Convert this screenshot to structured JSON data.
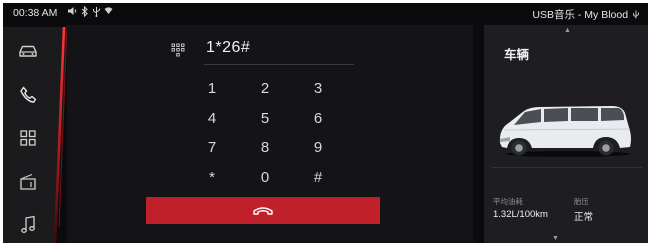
{
  "status_bar": {
    "time": "00:38 AM",
    "icons": [
      "speaker-icon",
      "bluetooth-icon",
      "usb-icon",
      "wifi-icon"
    ],
    "media": "USB音乐 - My Blood"
  },
  "nav": {
    "items": [
      {
        "name": "car",
        "icon": "car-icon",
        "active": false
      },
      {
        "name": "phone",
        "icon": "phone-icon",
        "active": true
      },
      {
        "name": "apps",
        "icon": "grid-icon",
        "active": false
      },
      {
        "name": "radio",
        "icon": "radio-icon",
        "active": false
      },
      {
        "name": "music",
        "icon": "music-note-icon",
        "active": false
      }
    ]
  },
  "dialer": {
    "number": "1*26#",
    "keys": [
      "1",
      "2",
      "3",
      "4",
      "5",
      "6",
      "7",
      "8",
      "9",
      "*",
      "0",
      "#"
    ],
    "call_icon": "hang-up-icon"
  },
  "vehicle": {
    "title": "车辆",
    "fuel_label": "平均油耗",
    "fuel_value": "1.32L/100km",
    "tire_label": "胎压",
    "tire_value": "正常",
    "car_color": "#e9ecef"
  },
  "colors": {
    "accent": "#c0202a",
    "background": "#0b0b0d",
    "panel": "#141418",
    "card": "#1e1e22"
  }
}
